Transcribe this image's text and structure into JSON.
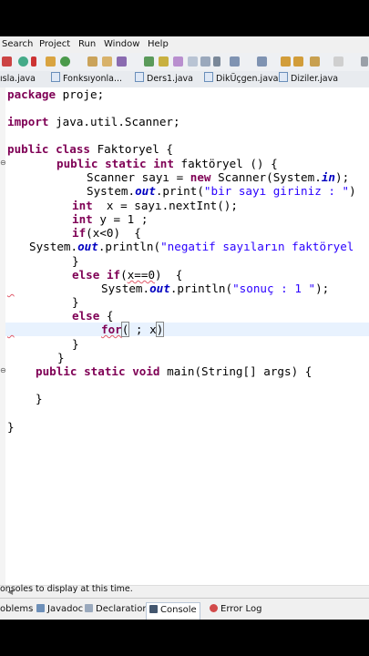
{
  "menu": [
    "Search",
    "Project",
    "Run",
    "Window",
    "Help"
  ],
  "tabs": [
    "ısla.java",
    "Fonksıyonla...",
    "Ders1.java",
    "DikÜçgen.java",
    "Diziler.java"
  ],
  "code": {
    "l1": [
      "package",
      " proje;"
    ],
    "l2": [
      "import",
      " java.util.Scanner;"
    ],
    "l3": [
      "public",
      "class",
      " Faktoryel {"
    ],
    "l4": [
      "public",
      "static",
      "int",
      " faktöryel () {"
    ],
    "l5": [
      "Scanner sayı = ",
      "new",
      " Scanner(System.",
      "in",
      ");"
    ],
    "l6": [
      "System.",
      "out",
      ".print(",
      "\"bir sayı giriniz : \"",
      ")"
    ],
    "l7": [
      "int",
      "  x = sayı.nextInt();"
    ],
    "l8": [
      "int",
      " y = 1 ;"
    ],
    "l9": [
      "if",
      "(x<0)  {"
    ],
    "l10": [
      "System.",
      "out",
      ".println(",
      "\"negatif sayıların faktöryel"
    ],
    "l11": [
      "}"
    ],
    "l12": [
      "else",
      "if",
      "(",
      "x==0",
      ")  {"
    ],
    "l13": [
      "System.",
      "out",
      ".println(",
      "\"sonuç : 1 \"",
      ");"
    ],
    "l14": [
      "}"
    ],
    "l15": [
      "else",
      " {"
    ],
    "l16": [
      "for",
      "(",
      " ; x",
      ")"
    ],
    "l17": [
      "}"
    ],
    "l18": [
      "}"
    ],
    "l19": [
      "public",
      "static",
      "void",
      " main(String[] args) {"
    ],
    "l20": [
      "}"
    ],
    "l21": [
      "}"
    ]
  },
  "bottom_tabs": [
    "oblems",
    "Javadoc",
    "Declaration",
    "Console",
    "Error Log"
  ],
  "console_text": "onsoles to display at this time.",
  "colors": {
    "keyword": "#7f0055",
    "string": "#2a00ff",
    "field": "#0000c0"
  }
}
